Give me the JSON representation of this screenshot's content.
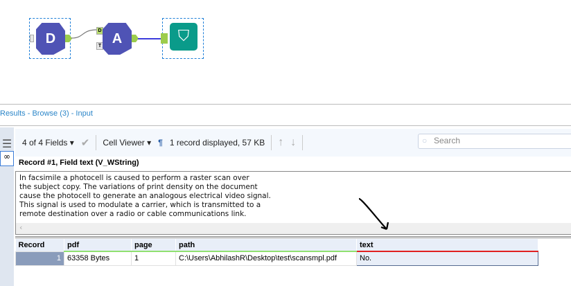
{
  "workflow": {
    "tools": [
      {
        "name": "input-tool",
        "glyph": "D"
      },
      {
        "name": "ocr-tool",
        "glyph": "A",
        "anchors": [
          "D",
          "T"
        ]
      },
      {
        "name": "browse-tool"
      }
    ]
  },
  "results": {
    "title": "Results - Browse (3) - Input"
  },
  "toolbar": {
    "fields": "4 of 4 Fields",
    "viewer": "Cell Viewer",
    "pilcrow": "¶",
    "status": "1 record displayed, 57 KB",
    "search_placeholder": "Search"
  },
  "cell": {
    "label": "Record #1, Field text (V_WString)",
    "text": "In facsimile a photocell is caused to perform a raster scan over\nthe subject copy. The variations of print density on the document\ncause the photocell to generate an analogous electrical video signal.\nThis signal is used to modulate a carrier, which is transmitted to a\nremote destination over a radio or cable communications link."
  },
  "grid": {
    "headers": [
      "Record",
      "pdf",
      "page",
      "path",
      "text"
    ],
    "rows": [
      [
        "1",
        "63358 Bytes",
        "1",
        "C:\\Users\\AbhilashR\\Desktop\\test\\scansmpl.pdf",
        "No."
      ]
    ]
  }
}
